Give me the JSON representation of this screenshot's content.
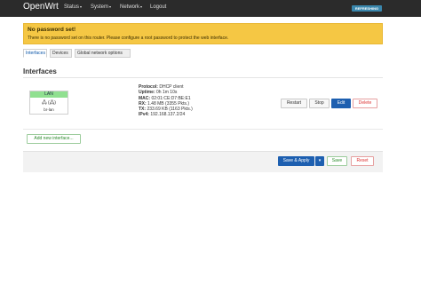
{
  "brand": "OpenWrt",
  "nav": {
    "status": "Status",
    "system": "System",
    "network": "Network",
    "logout": "Logout",
    "caret": "▾"
  },
  "refresh_badge": "REFRESHING",
  "alert": {
    "title": "No password set!",
    "text": "There is no password set on this router. Please configure a root password to protect the web interface."
  },
  "tabs": [
    "Interfaces",
    "Devices",
    "Global network options"
  ],
  "section_title": "Interfaces",
  "interface": {
    "name": "LAN",
    "icon": "🖧 (🖧)",
    "device": "br-lan",
    "protocol_label": "Protocol:",
    "protocol": "DHCP client",
    "uptime_label": "Uptime:",
    "uptime": "0h 1m 10s",
    "mac_label": "MAC:",
    "mac": "02:01:CE:D7:BE:E1",
    "rx_label": "RX:",
    "rx": "1.48 MB (3355 Pkts.)",
    "tx_label": "TX:",
    "tx": "233.69 KB (1163 Pkts.)",
    "ipv4_label": "IPv4:",
    "ipv4": "192.168.137.2/24"
  },
  "buttons": {
    "restart": "Restart",
    "stop": "Stop",
    "edit": "Edit",
    "delete": "Delete",
    "add_interface": "Add new interface...",
    "save_apply": "Save & Apply",
    "save_apply_caret": "▾",
    "save": "Save",
    "reset": "Reset"
  },
  "colors": {
    "navbar": "#2b2b2b",
    "alert": "#f5c744",
    "iface_header": "#90e090",
    "primary": "#1d5fb0"
  }
}
